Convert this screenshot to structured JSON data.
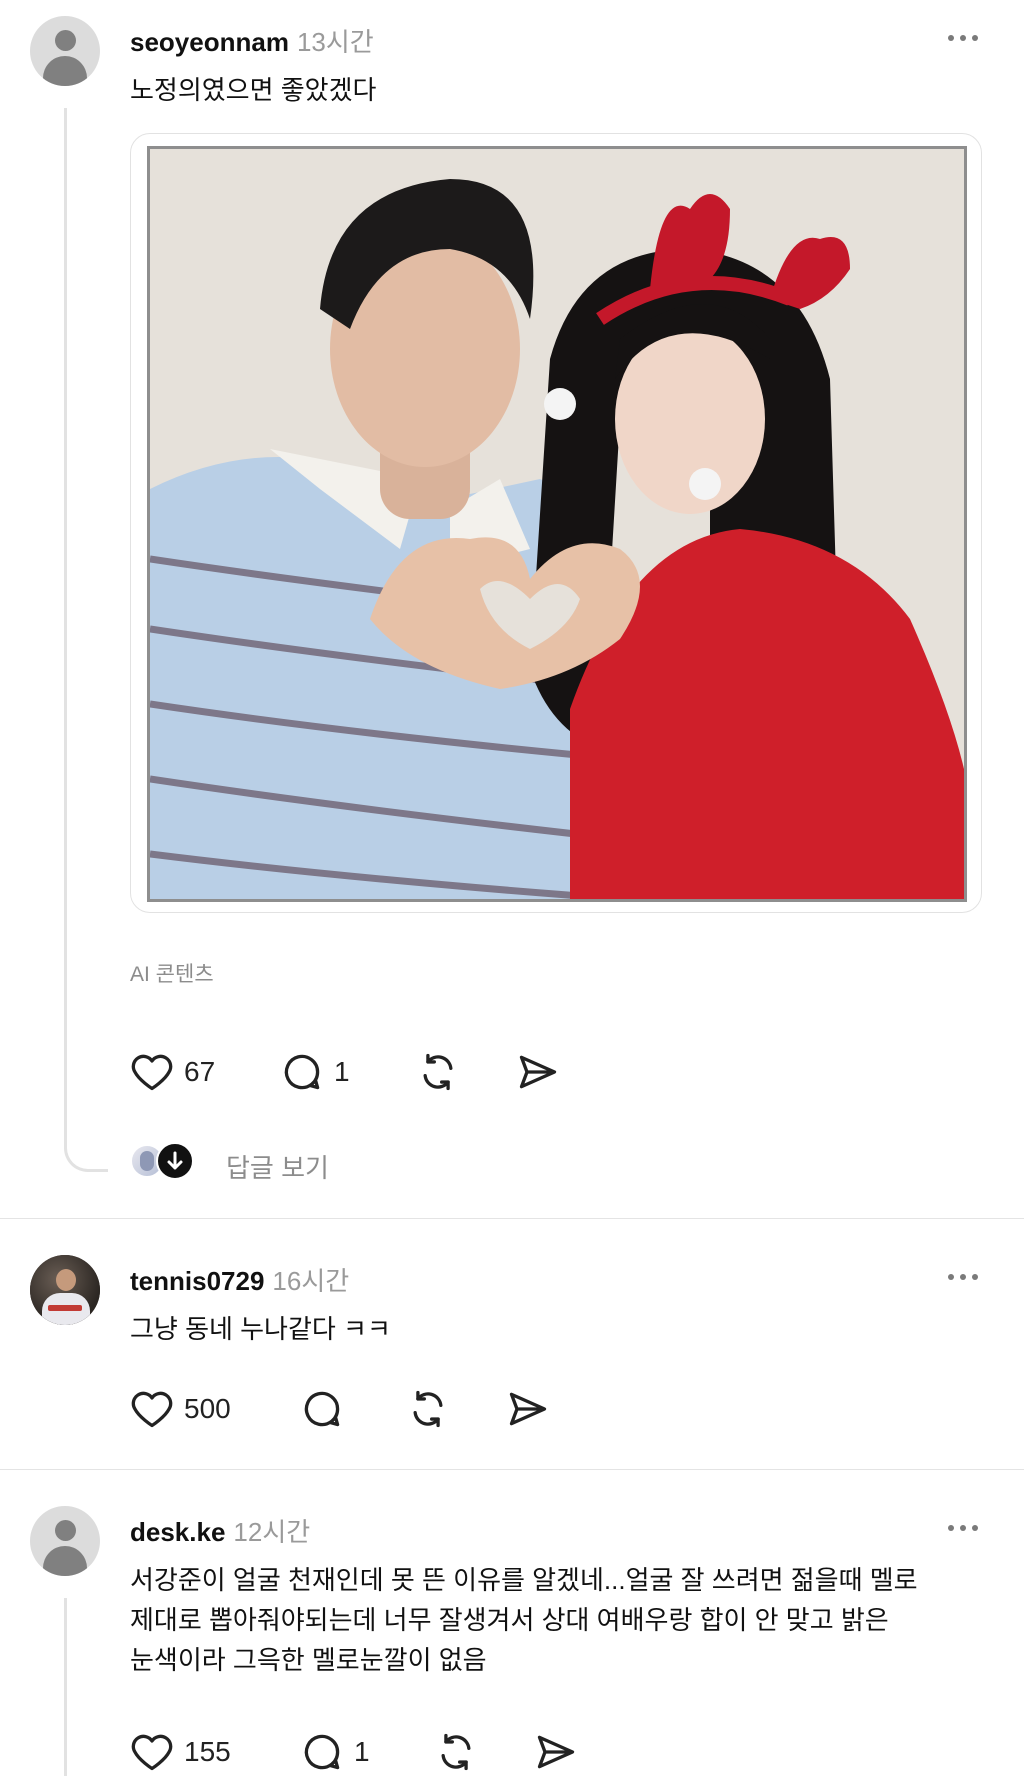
{
  "posts": [
    {
      "username": "seoyeonnam",
      "time": "13시간",
      "text": "노정의였으면 좋았겠다",
      "content_tag": "AI 콘텐츠",
      "likes": "67",
      "comments": "1",
      "view_replies": "답글 보기",
      "more_icon": "more-icon"
    },
    {
      "username": "tennis0729",
      "time": "16시간",
      "text": "그냥 동네 누나같다 ㅋㅋ",
      "likes": "500",
      "comments": ""
    },
    {
      "username": "desk.ke",
      "time": "12시간",
      "text_lines": [
        "서강준이 얼굴 천재인데 못 뜬 이유를 알겠네...얼굴 잘 쓰려면 젊을때 멜로",
        "제대로 뽑아줘야되는데 너무 잘생겨서 상대 여배우랑 합이 안 맞고 밝은",
        "눈색이라 그윽한 멜로눈깔이 없음"
      ],
      "likes": "155",
      "comments": "1"
    }
  ],
  "icons": [
    "heart-icon",
    "comment-icon",
    "repost-icon",
    "share-icon",
    "more-icon",
    "arrow-down-icon"
  ],
  "colors": {
    "text": "#111111",
    "muted": "#9a9a9a",
    "divider": "#e4e4e4",
    "icon": "#222222"
  }
}
